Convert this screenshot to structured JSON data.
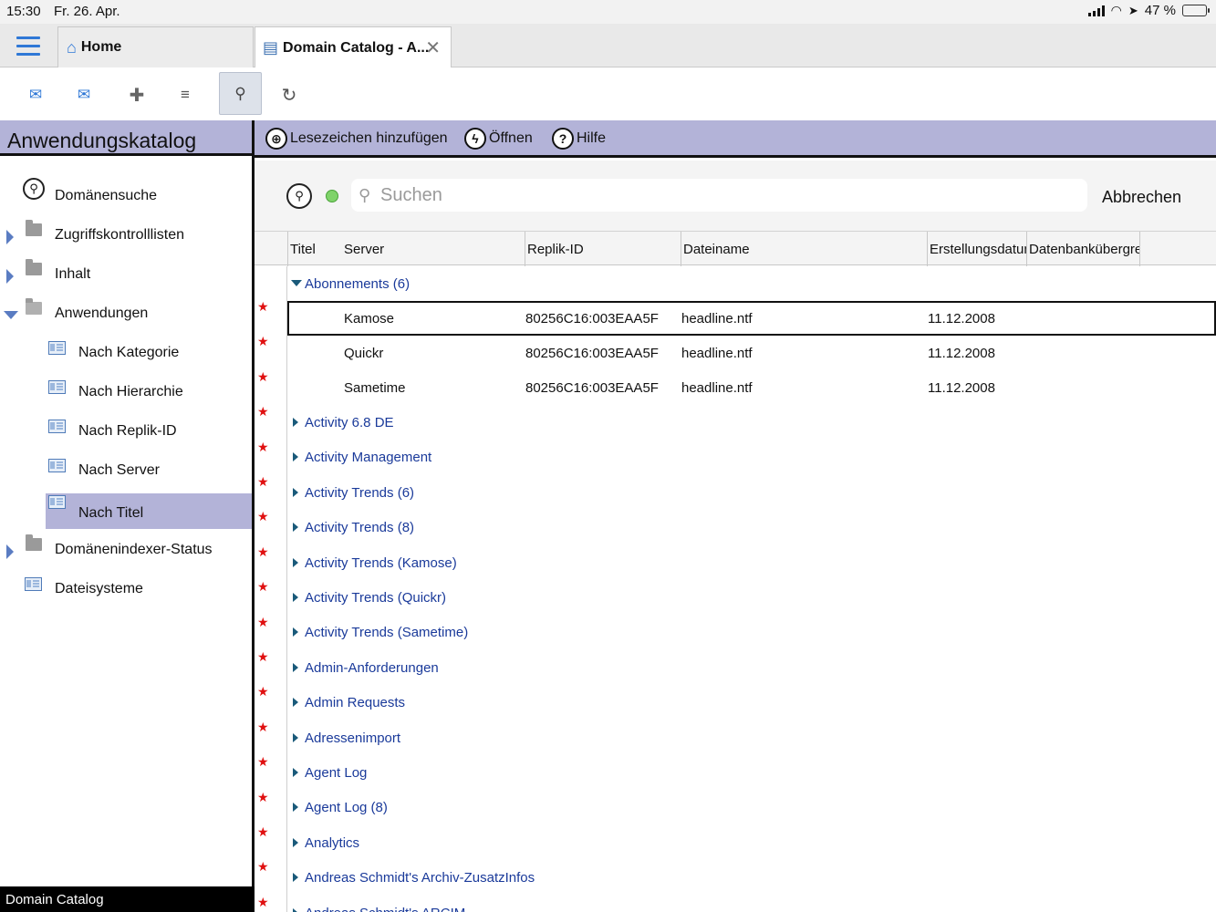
{
  "statusbar": {
    "time": "15:30",
    "date": "Fr. 26. Apr.",
    "battery": "47 %",
    "battery_level": 0.47
  },
  "tabs": [
    {
      "label": "Home",
      "icon": "home-icon"
    },
    {
      "label": "Domain Catalog - A...",
      "icon": "catalog-icon"
    }
  ],
  "toolbar": {
    "icons": [
      "mail-down-icon",
      "mail-up-icon",
      "add-icon",
      "stack-icon",
      "search-icon",
      "refresh-icon"
    ]
  },
  "left": {
    "title": "Anwendungskatalog",
    "items": [
      {
        "label": "Domänensuche"
      },
      {
        "label": "Zugriffskontrolllisten"
      },
      {
        "label": "Inhalt"
      },
      {
        "label": "Anwendungen"
      },
      {
        "label": "Nach Kategorie"
      },
      {
        "label": "Nach Hierarchie"
      },
      {
        "label": "Nach Replik-ID"
      },
      {
        "label": "Nach Server"
      },
      {
        "label": "Nach Titel"
      },
      {
        "label": "Domänenindexer-Status"
      },
      {
        "label": "Dateisysteme"
      }
    ],
    "footer": "Domain Catalog"
  },
  "actions": {
    "bookmark": "Lesezeichen hinzufügen",
    "open": "Öffnen",
    "help": "Hilfe"
  },
  "search": {
    "placeholder": "Suchen",
    "value": "",
    "cancel": "Abbrechen"
  },
  "columns": [
    "Titel",
    "Server",
    "Replik-ID",
    "Dateiname",
    "Erstellungsdatum",
    "Datenbankübergreifend"
  ],
  "group_open": {
    "label": "Abonnements (6)"
  },
  "rows": [
    {
      "server": "Kamose",
      "replica": "80256C16:003EAA5F",
      "file": "headline.ntf",
      "date": "11.12.2008"
    },
    {
      "server": "Quickr",
      "replica": "80256C16:003EAA5F",
      "file": "headline.ntf",
      "date": "11.12.2008"
    },
    {
      "server": "Sametime",
      "replica": "80256C16:003EAA5F",
      "file": "headline.ntf",
      "date": "11.12.2008"
    }
  ],
  "categories": [
    "Activity 6.8 DE",
    "Activity Management",
    "Activity Trends (6)",
    "Activity Trends (8)",
    "Activity Trends (Kamose)",
    "Activity Trends (Quickr)",
    "Activity Trends (Sametime)",
    "Admin-Anforderungen",
    "Admin Requests",
    "Adressenimport",
    "Agent Log",
    "Agent Log (8)",
    "Analytics",
    "Andreas Schmidt's Archiv-ZusatzInfos",
    "Andreas Schmidt's ARCIM"
  ],
  "colors": {
    "accent": "#b3b3d8",
    "link": "#1a3a9a",
    "star": "#e01010",
    "tab_icon": "#2f78d6"
  }
}
